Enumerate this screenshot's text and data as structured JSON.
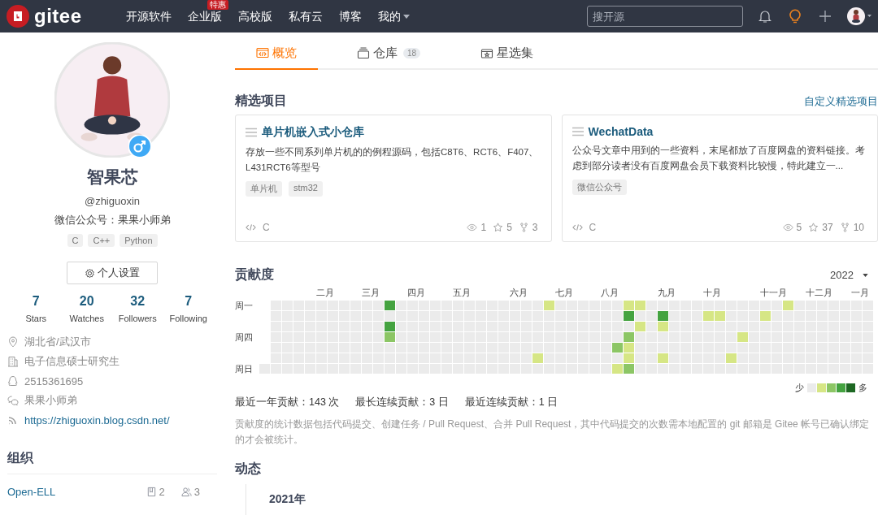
{
  "navbar": {
    "logo": "gitee",
    "items": [
      {
        "label": "开源软件"
      },
      {
        "label": "企业版",
        "badge": "特惠"
      },
      {
        "label": "高校版"
      },
      {
        "label": "私有云"
      },
      {
        "label": "博客"
      },
      {
        "label": "我的",
        "dropdown": true
      }
    ],
    "search": {
      "placeholder": "搜开源"
    }
  },
  "profile": {
    "name": "智果芯",
    "username": "@zhiguoxin",
    "bio": "微信公众号：果果小师弟",
    "languages": [
      "C",
      "C++",
      "Python"
    ],
    "settings_button": "个人设置",
    "stats": [
      {
        "value": "7",
        "label": "Stars"
      },
      {
        "value": "20",
        "label": "Watches"
      },
      {
        "value": "32",
        "label": "Followers"
      },
      {
        "value": "7",
        "label": "Following"
      }
    ],
    "info": [
      {
        "kind": "location",
        "text": "湖北省/武汉市"
      },
      {
        "kind": "company",
        "text": "电子信息硕士研究生"
      },
      {
        "kind": "qq",
        "text": "2515361695"
      },
      {
        "kind": "wechat",
        "text": "果果小师弟"
      },
      {
        "kind": "blog",
        "text": "https://zhiguoxin.blog.csdn.net/"
      }
    ]
  },
  "organizations": {
    "title": "组织",
    "items": [
      {
        "name": "Open-ELL",
        "repos": "2",
        "members": "3"
      }
    ]
  },
  "tabs": [
    {
      "label": "概览",
      "selected": true
    },
    {
      "label": "仓库",
      "count": "18",
      "selected": false
    },
    {
      "label": "星选集",
      "selected": false
    }
  ],
  "featured": {
    "title": "精选项目",
    "action": "自定义精选项目",
    "projects": [
      {
        "name": "单片机嵌入式小仓库",
        "description": "存放一些不同系列单片机的的例程源码，包括C8T6、RCT6、F407、L431RCT6等型号",
        "tags": [
          "单片机",
          "stm32"
        ],
        "language": "C",
        "watches": "1",
        "stars": "5",
        "forks": "3"
      },
      {
        "name": "WechatData",
        "description": "公众号文章中用到的一些资料，末尾都放了百度网盘的资料链接。考虑到部分读者没有百度网盘会员下载资料比较慢，特此建立一...",
        "tags": [
          "微信公众号"
        ],
        "language": "C",
        "watches": "5",
        "stars": "37",
        "forks": "10"
      }
    ]
  },
  "contributions": {
    "title": "贡献度",
    "year": "2022",
    "months": [
      "二月",
      "三月",
      "四月",
      "五月",
      "六月",
      "七月",
      "八月",
      "九月",
      "十月",
      "十一月",
      "十二月",
      "一月"
    ],
    "rows": [
      {
        "label": "周一",
        "cells": [
          {
            "color": "#ebebeb"
          },
          {
            "color": "#ebebeb"
          },
          {
            "color": "#ebebeb"
          },
          {
            "color": "#ebebeb"
          },
          {
            "color": "#ebebeb"
          },
          {
            "color": "#ebebeb"
          },
          {
            "color": "#ebebeb"
          },
          {
            "color": "#ebebeb"
          },
          {
            "color": "#ebebeb"
          },
          {
            "color": "#ebebeb"
          },
          {
            "color": "#44a340"
          },
          {
            "color": "#ebebeb"
          },
          {
            "color": "#ebebeb"
          },
          {
            "color": "#ebebeb"
          },
          {
            "color": "#ebebeb"
          },
          {
            "color": "#ebebeb"
          },
          {
            "color": "#ebebeb"
          },
          {
            "color": "#ebebeb"
          },
          {
            "color": "#ebebeb"
          },
          {
            "color": "#ebebeb"
          },
          {
            "color": "#ebebeb"
          },
          {
            "color": "#ebebeb"
          },
          {
            "color": "#ebebeb"
          },
          {
            "color": "#ebebeb"
          },
          {
            "color": "#d6e685"
          },
          {
            "color": "#ebebeb"
          },
          {
            "color": "#ebebeb"
          },
          {
            "color": "#ebebeb"
          },
          {
            "color": "#ebebeb"
          },
          {
            "color": "#ebebeb"
          },
          {
            "color": "#ebebeb"
          },
          {
            "color": "#d6e685"
          },
          {
            "color": "#d6e685"
          },
          {
            "color": "#ebebeb"
          },
          {
            "color": "#ebebeb"
          },
          {
            "color": "#ebebeb"
          },
          {
            "color": "#ebebeb"
          },
          {
            "color": "#ebebeb"
          },
          {
            "color": "#ebebeb"
          },
          {
            "color": "#ebebeb"
          },
          {
            "color": "#ebebeb"
          },
          {
            "color": "#ebebeb"
          },
          {
            "color": "#ebebeb"
          },
          {
            "color": "#ebebeb"
          },
          {
            "color": "#ebebeb"
          },
          {
            "color": "#d6e685"
          },
          {
            "color": "#ebebeb"
          },
          {
            "color": "#ebebeb"
          },
          {
            "color": "#ebebeb"
          },
          {
            "color": "#ebebeb"
          },
          {
            "color": "#ebebeb"
          },
          {
            "color": "#ebebeb"
          },
          {
            "color": "#ebebeb"
          }
        ]
      },
      {
        "cells": [
          {
            "color": "#ebebeb"
          },
          {
            "color": "#ebebeb"
          },
          {
            "color": "#ebebeb"
          },
          {
            "color": "#ebebeb"
          },
          {
            "color": "#ebebeb"
          },
          {
            "color": "#ebebeb"
          },
          {
            "color": "#ebebeb"
          },
          {
            "color": "#ebebeb"
          },
          {
            "color": "#ebebeb"
          },
          {
            "color": "#ebebeb"
          },
          {
            "color": "#ebebeb"
          },
          {
            "color": "#ebebeb"
          },
          {
            "color": "#ebebeb"
          },
          {
            "color": "#ebebeb"
          },
          {
            "color": "#ebebeb"
          },
          {
            "color": "#ebebeb"
          },
          {
            "color": "#ebebeb"
          },
          {
            "color": "#ebebeb"
          },
          {
            "color": "#ebebeb"
          },
          {
            "color": "#ebebeb"
          },
          {
            "color": "#ebebeb"
          },
          {
            "color": "#ebebeb"
          },
          {
            "color": "#ebebeb"
          },
          {
            "color": "#ebebeb"
          },
          {
            "color": "#ebebeb"
          },
          {
            "color": "#ebebeb"
          },
          {
            "color": "#ebebeb"
          },
          {
            "color": "#ebebeb"
          },
          {
            "color": "#ebebeb"
          },
          {
            "color": "#ebebeb"
          },
          {
            "color": "#ebebeb"
          },
          {
            "color": "#44a340"
          },
          {
            "color": "#ebebeb"
          },
          {
            "color": "#ebebeb"
          },
          {
            "color": "#44a340"
          },
          {
            "color": "#ebebeb"
          },
          {
            "color": "#ebebeb"
          },
          {
            "color": "#ebebeb"
          },
          {
            "color": "#d6e685"
          },
          {
            "color": "#d6e685"
          },
          {
            "color": "#ebebeb"
          },
          {
            "color": "#ebebeb"
          },
          {
            "color": "#ebebeb"
          },
          {
            "color": "#d6e685"
          },
          {
            "color": "#ebebeb"
          },
          {
            "color": "#ebebeb"
          },
          {
            "color": "#ebebeb"
          },
          {
            "color": "#ebebeb"
          },
          {
            "color": "#ebebeb"
          },
          {
            "color": "#ebebeb"
          },
          {
            "color": "#ebebeb"
          },
          {
            "color": "#ebebeb"
          },
          {
            "color": "#ebebeb"
          }
        ]
      },
      {
        "cells": [
          {
            "color": "#ebebeb"
          },
          {
            "color": "#ebebeb"
          },
          {
            "color": "#ebebeb"
          },
          {
            "color": "#ebebeb"
          },
          {
            "color": "#ebebeb"
          },
          {
            "color": "#ebebeb"
          },
          {
            "color": "#ebebeb"
          },
          {
            "color": "#ebebeb"
          },
          {
            "color": "#ebebeb"
          },
          {
            "color": "#ebebeb"
          },
          {
            "color": "#44a340"
          },
          {
            "color": "#ebebeb"
          },
          {
            "color": "#ebebeb"
          },
          {
            "color": "#ebebeb"
          },
          {
            "color": "#ebebeb"
          },
          {
            "color": "#ebebeb"
          },
          {
            "color": "#ebebeb"
          },
          {
            "color": "#ebebeb"
          },
          {
            "color": "#ebebeb"
          },
          {
            "color": "#ebebeb"
          },
          {
            "color": "#ebebeb"
          },
          {
            "color": "#ebebeb"
          },
          {
            "color": "#ebebeb"
          },
          {
            "color": "#ebebeb"
          },
          {
            "color": "#ebebeb"
          },
          {
            "color": "#ebebeb"
          },
          {
            "color": "#ebebeb"
          },
          {
            "color": "#ebebeb"
          },
          {
            "color": "#ebebeb"
          },
          {
            "color": "#ebebeb"
          },
          {
            "color": "#ebebeb"
          },
          {
            "color": "#ebebeb"
          },
          {
            "color": "#d6e685"
          },
          {
            "color": "#ebebeb"
          },
          {
            "color": "#d6e685"
          },
          {
            "color": "#ebebeb"
          },
          {
            "color": "#ebebeb"
          },
          {
            "color": "#ebebeb"
          },
          {
            "color": "#ebebeb"
          },
          {
            "color": "#ebebeb"
          },
          {
            "color": "#ebebeb"
          },
          {
            "color": "#ebebeb"
          },
          {
            "color": "#ebebeb"
          },
          {
            "color": "#ebebeb"
          },
          {
            "color": "#ebebeb"
          },
          {
            "color": "#ebebeb"
          },
          {
            "color": "#ebebeb"
          },
          {
            "color": "#ebebeb"
          },
          {
            "color": "#ebebeb"
          },
          {
            "color": "#ebebeb"
          },
          {
            "color": "#ebebeb"
          },
          {
            "color": "#ebebeb"
          },
          {
            "color": "#ebebeb"
          }
        ]
      },
      {
        "label": "周四",
        "cells": [
          {
            "color": "#ebebeb"
          },
          {
            "color": "#ebebeb"
          },
          {
            "color": "#ebebeb"
          },
          {
            "color": "#ebebeb"
          },
          {
            "color": "#ebebeb"
          },
          {
            "color": "#ebebeb"
          },
          {
            "color": "#ebebeb"
          },
          {
            "color": "#ebebeb"
          },
          {
            "color": "#ebebeb"
          },
          {
            "color": "#ebebeb"
          },
          {
            "color": "#8cc665"
          },
          {
            "color": "#ebebeb"
          },
          {
            "color": "#ebebeb"
          },
          {
            "color": "#ebebeb"
          },
          {
            "color": "#ebebeb"
          },
          {
            "color": "#ebebeb"
          },
          {
            "color": "#ebebeb"
          },
          {
            "color": "#ebebeb"
          },
          {
            "color": "#ebebeb"
          },
          {
            "color": "#ebebeb"
          },
          {
            "color": "#ebebeb"
          },
          {
            "color": "#ebebeb"
          },
          {
            "color": "#ebebeb"
          },
          {
            "color": "#ebebeb"
          },
          {
            "color": "#ebebeb"
          },
          {
            "color": "#ebebeb"
          },
          {
            "color": "#ebebeb"
          },
          {
            "color": "#ebebeb"
          },
          {
            "color": "#ebebeb"
          },
          {
            "color": "#ebebeb"
          },
          {
            "color": "#ebebeb"
          },
          {
            "color": "#8cc665"
          },
          {
            "color": "#ebebeb"
          },
          {
            "color": "#ebebeb"
          },
          {
            "color": "#ebebeb"
          },
          {
            "color": "#ebebeb"
          },
          {
            "color": "#ebebeb"
          },
          {
            "color": "#ebebeb"
          },
          {
            "color": "#ebebeb"
          },
          {
            "color": "#ebebeb"
          },
          {
            "color": "#ebebeb"
          },
          {
            "color": "#d6e685"
          },
          {
            "color": "#ebebeb"
          },
          {
            "color": "#ebebeb"
          },
          {
            "color": "#ebebeb"
          },
          {
            "color": "#ebebeb"
          },
          {
            "color": "#ebebeb"
          },
          {
            "color": "#ebebeb"
          },
          {
            "color": "#ebebeb"
          },
          {
            "color": "#ebebeb"
          },
          {
            "color": "#ebebeb"
          },
          {
            "color": "#ebebeb"
          },
          {
            "color": "#ebebeb"
          }
        ]
      },
      {
        "cells": [
          {
            "color": "#ebebeb"
          },
          {
            "color": "#ebebeb"
          },
          {
            "color": "#ebebeb"
          },
          {
            "color": "#ebebeb"
          },
          {
            "color": "#ebebeb"
          },
          {
            "color": "#ebebeb"
          },
          {
            "color": "#ebebeb"
          },
          {
            "color": "#ebebeb"
          },
          {
            "color": "#ebebeb"
          },
          {
            "color": "#ebebeb"
          },
          {
            "color": "#ebebeb"
          },
          {
            "color": "#ebebeb"
          },
          {
            "color": "#ebebeb"
          },
          {
            "color": "#ebebeb"
          },
          {
            "color": "#ebebeb"
          },
          {
            "color": "#ebebeb"
          },
          {
            "color": "#ebebeb"
          },
          {
            "color": "#ebebeb"
          },
          {
            "color": "#ebebeb"
          },
          {
            "color": "#ebebeb"
          },
          {
            "color": "#ebebeb"
          },
          {
            "color": "#ebebeb"
          },
          {
            "color": "#ebebeb"
          },
          {
            "color": "#ebebeb"
          },
          {
            "color": "#ebebeb"
          },
          {
            "color": "#ebebeb"
          },
          {
            "color": "#ebebeb"
          },
          {
            "color": "#ebebeb"
          },
          {
            "color": "#ebebeb"
          },
          {
            "color": "#ebebeb"
          },
          {
            "color": "#8cc665"
          },
          {
            "color": "#d6e685"
          },
          {
            "color": "#ebebeb"
          },
          {
            "color": "#ebebeb"
          },
          {
            "color": "#ebebeb"
          },
          {
            "color": "#ebebeb"
          },
          {
            "color": "#ebebeb"
          },
          {
            "color": "#ebebeb"
          },
          {
            "color": "#ebebeb"
          },
          {
            "color": "#ebebeb"
          },
          {
            "color": "#ebebeb"
          },
          {
            "color": "#ebebeb"
          },
          {
            "color": "#ebebeb"
          },
          {
            "color": "#ebebeb"
          },
          {
            "color": "#ebebeb"
          },
          {
            "color": "#ebebeb"
          },
          {
            "color": "#ebebeb"
          },
          {
            "color": "#ebebeb"
          },
          {
            "color": "#ebebeb"
          },
          {
            "color": "#ebebeb"
          },
          {
            "color": "#ebebeb"
          },
          {
            "color": "#ebebeb"
          },
          {
            "color": "#ebebeb"
          }
        ]
      },
      {
        "cells": [
          {
            "color": "#ebebeb"
          },
          {
            "color": "#ebebeb"
          },
          {
            "color": "#ebebeb"
          },
          {
            "color": "#ebebeb"
          },
          {
            "color": "#ebebeb"
          },
          {
            "color": "#ebebeb"
          },
          {
            "color": "#ebebeb"
          },
          {
            "color": "#ebebeb"
          },
          {
            "color": "#ebebeb"
          },
          {
            "color": "#ebebeb"
          },
          {
            "color": "#ebebeb"
          },
          {
            "color": "#ebebeb"
          },
          {
            "color": "#ebebeb"
          },
          {
            "color": "#ebebeb"
          },
          {
            "color": "#ebebeb"
          },
          {
            "color": "#ebebeb"
          },
          {
            "color": "#ebebeb"
          },
          {
            "color": "#ebebeb"
          },
          {
            "color": "#ebebeb"
          },
          {
            "color": "#ebebeb"
          },
          {
            "color": "#ebebeb"
          },
          {
            "color": "#ebebeb"
          },
          {
            "color": "#ebebeb"
          },
          {
            "color": "#d6e685"
          },
          {
            "color": "#ebebeb"
          },
          {
            "color": "#ebebeb"
          },
          {
            "color": "#ebebeb"
          },
          {
            "color": "#ebebeb"
          },
          {
            "color": "#ebebeb"
          },
          {
            "color": "#ebebeb"
          },
          {
            "color": "#ebebeb"
          },
          {
            "color": "#d6e685"
          },
          {
            "color": "#ebebeb"
          },
          {
            "color": "#ebebeb"
          },
          {
            "color": "#d6e685"
          },
          {
            "color": "#ebebeb"
          },
          {
            "color": "#ebebeb"
          },
          {
            "color": "#ebebeb"
          },
          {
            "color": "#ebebeb"
          },
          {
            "color": "#ebebeb"
          },
          {
            "color": "#d6e685"
          },
          {
            "color": "#ebebeb"
          },
          {
            "color": "#ebebeb"
          },
          {
            "color": "#ebebeb"
          },
          {
            "color": "#ebebeb"
          },
          {
            "color": "#ebebeb"
          },
          {
            "color": "#ebebeb"
          },
          {
            "color": "#ebebeb"
          },
          {
            "color": "#ebebeb"
          },
          {
            "color": "#ebebeb"
          },
          {
            "color": "#ebebeb"
          },
          {
            "color": "#ebebeb"
          },
          {
            "color": "#ebebeb"
          }
        ]
      },
      {
        "label": "周日",
        "cells": [
          {
            "color": "#ebebeb"
          },
          {
            "color": "#ebebeb"
          },
          {
            "color": "#ebebeb"
          },
          {
            "color": "#ebebeb"
          },
          {
            "color": "#ebebeb"
          },
          {
            "color": "#ebebeb"
          },
          {
            "color": "#ebebeb"
          },
          {
            "color": "#ebebeb"
          },
          {
            "color": "#ebebeb"
          },
          {
            "color": "#ebebeb"
          },
          {
            "color": "#ebebeb"
          },
          {
            "color": "#ebebeb"
          },
          {
            "color": "#ebebeb"
          },
          {
            "color": "#ebebeb"
          },
          {
            "color": "#ebebeb"
          },
          {
            "color": "#ebebeb"
          },
          {
            "color": "#ebebeb"
          },
          {
            "color": "#ebebeb"
          },
          {
            "color": "#ebebeb"
          },
          {
            "color": "#ebebeb"
          },
          {
            "color": "#ebebeb"
          },
          {
            "color": "#ebebeb"
          },
          {
            "color": "#ebebeb"
          },
          {
            "color": "#ebebeb"
          },
          {
            "color": "#ebebeb"
          },
          {
            "color": "#ebebeb"
          },
          {
            "color": "#ebebeb"
          },
          {
            "color": "#ebebeb"
          },
          {
            "color": "#ebebeb"
          },
          {
            "color": "#ebebeb"
          },
          {
            "color": "#ebebeb"
          },
          {
            "color": "#d6e685"
          },
          {
            "color": "#8cc665"
          },
          {
            "color": "#ebebeb"
          },
          {
            "color": "#ebebeb"
          },
          {
            "color": "#ebebeb"
          },
          {
            "color": "#ebebeb"
          },
          {
            "color": "#ebebeb"
          },
          {
            "color": "#ebebeb"
          },
          {
            "color": "#ebebeb"
          },
          {
            "color": "#ebebeb"
          },
          {
            "color": "#ebebeb"
          },
          {
            "color": "#ebebeb"
          },
          {
            "color": "#ebebeb"
          },
          {
            "color": "#ebebeb"
          },
          {
            "color": "#ebebeb"
          },
          {
            "color": "#ebebeb"
          },
          {
            "color": "#ebebeb"
          },
          {
            "color": "#ebebeb"
          },
          {
            "color": "#ebebeb"
          },
          {
            "color": "#ebebeb"
          },
          {
            "color": "#ebebeb"
          },
          {
            "color": "#ebebeb"
          },
          {
            "color": "#ebebeb"
          }
        ]
      }
    ],
    "legend": {
      "less": "少",
      "more": "多",
      "swatches": [
        {
          "color": "#ebebeb"
        },
        {
          "color": "#d6e685"
        },
        {
          "color": "#8cc665"
        },
        {
          "color": "#44a340"
        },
        {
          "color": "#1e6823"
        }
      ]
    },
    "summary": [
      "最近一年贡献：143 次",
      "最长连续贡献：3 日",
      "最近连续贡献：1 日"
    ],
    "note": "贡献度的统计数据包括代码提交、创建任务 / Pull Request、合并 Pull Request，其中代码提交的次数需本地配置的 git 邮箱是 Gitee 帐号已确认绑定的才会被统计。"
  },
  "activity": {
    "title": "动态",
    "year": "2021年"
  }
}
